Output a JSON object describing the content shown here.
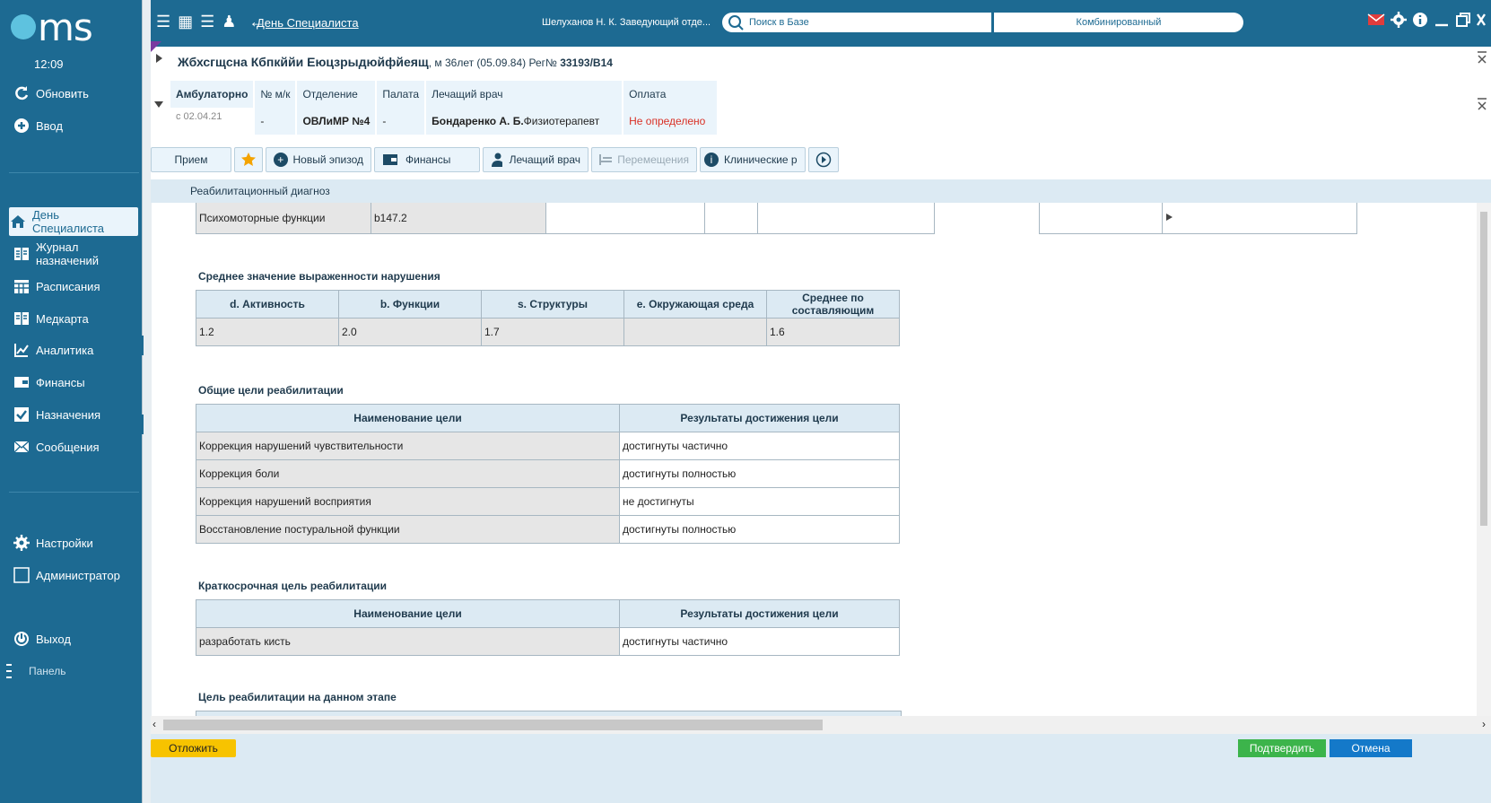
{
  "app": {
    "logo": "ms",
    "time": "12:09"
  },
  "sidebar": {
    "refresh": "Обновить",
    "input": "Ввод",
    "items": [
      {
        "label": "День Специалиста",
        "icon": "home-icon"
      },
      {
        "label": "Журнал назначений",
        "icon": "journal-icon"
      },
      {
        "label": "Расписания",
        "icon": "calendar-icon"
      },
      {
        "label": "Медкарта",
        "icon": "medcard-icon"
      },
      {
        "label": "Аналитика",
        "icon": "analytics-icon"
      },
      {
        "label": "Финансы",
        "icon": "finance-icon"
      },
      {
        "label": "Назначения",
        "icon": "checkbox-icon"
      },
      {
        "label": "Сообщения",
        "icon": "mail-icon"
      }
    ],
    "settings": "Настройки",
    "admin": "Администратор",
    "logout": "Выход",
    "panel": "Панель"
  },
  "topbar": {
    "link": "День Специалиста",
    "user": "Шелуханов Н. К. Заведующий отде...",
    "search_placeholder": "Поиск в Базе",
    "combo": "Комбинированный"
  },
  "patient": {
    "name": "Жбхсгщсна Кбпкййи Еюцзрыдюйфйеящ",
    "details": ", м 36лет (05.09.84) Рег№ ",
    "reg": "33193/В14",
    "mode": "Амбулаторно",
    "since": "с 02.04.21",
    "headers": {
      "card": "№ м/к",
      "dept": "Отделение",
      "ward": "Палата",
      "doctor": "Лечащий врач",
      "payment": "Оплата"
    },
    "values": {
      "card": "-",
      "dept": "ОВЛиМР №4",
      "ward": "-",
      "doctor": "Бондаренко А. Б.",
      "doctor_role": "Физиотерапевт",
      "payment": "Не определено"
    }
  },
  "toolbar": {
    "reception": "Прием",
    "new_episode": "Новый эпизод",
    "finances": "Финансы",
    "doctor": "Лечащий врач",
    "movements": "Перемещения",
    "clinical": "Клинические р"
  },
  "section_title": "Реабилитационный диагноз",
  "diag_row": {
    "name": "Психомоторные функции",
    "code": "b147.2"
  },
  "avg": {
    "title": "Среднее значение выраженности нарушения",
    "headers": [
      "d. Активность",
      "b. Функции",
      "s. Структуры",
      "e. Окружающая среда",
      "Среднее по составляющим"
    ],
    "values": [
      "1.2",
      "2.0",
      "1.7",
      "",
      "1.6"
    ]
  },
  "general_goals": {
    "title": "Общие цели реабилитации",
    "headers": [
      "Наименование цели",
      "Результаты достижения цели"
    ],
    "rows": [
      [
        "Коррекция нарушений чувствительности",
        "достигнуты частично"
      ],
      [
        "Коррекция боли",
        "достигнуты полностью"
      ],
      [
        "Коррекция нарушений восприятия",
        "не достигнуты"
      ],
      [
        "Восстановление постуральной функции",
        "достигнуты полностью"
      ]
    ]
  },
  "short_goals": {
    "title": "Краткосрочная цель реабилитации",
    "headers": [
      "Наименование цели",
      "Результаты достижения цели"
    ],
    "rows": [
      [
        "разработать кисть",
        "достигнуты частично"
      ]
    ]
  },
  "stage_goal": {
    "title": "Цель реабилитации на данном этапе"
  },
  "footer": {
    "postpone": "Отложить",
    "confirm": "Подтвердить",
    "cancel": "Отмена"
  },
  "colors": {
    "brand": "#1d6a92",
    "accent_light": "#dceaf3",
    "warn": "#d93025",
    "confirm": "#3cb44b",
    "cancel": "#1479c9",
    "postpone": "#f7c300"
  }
}
